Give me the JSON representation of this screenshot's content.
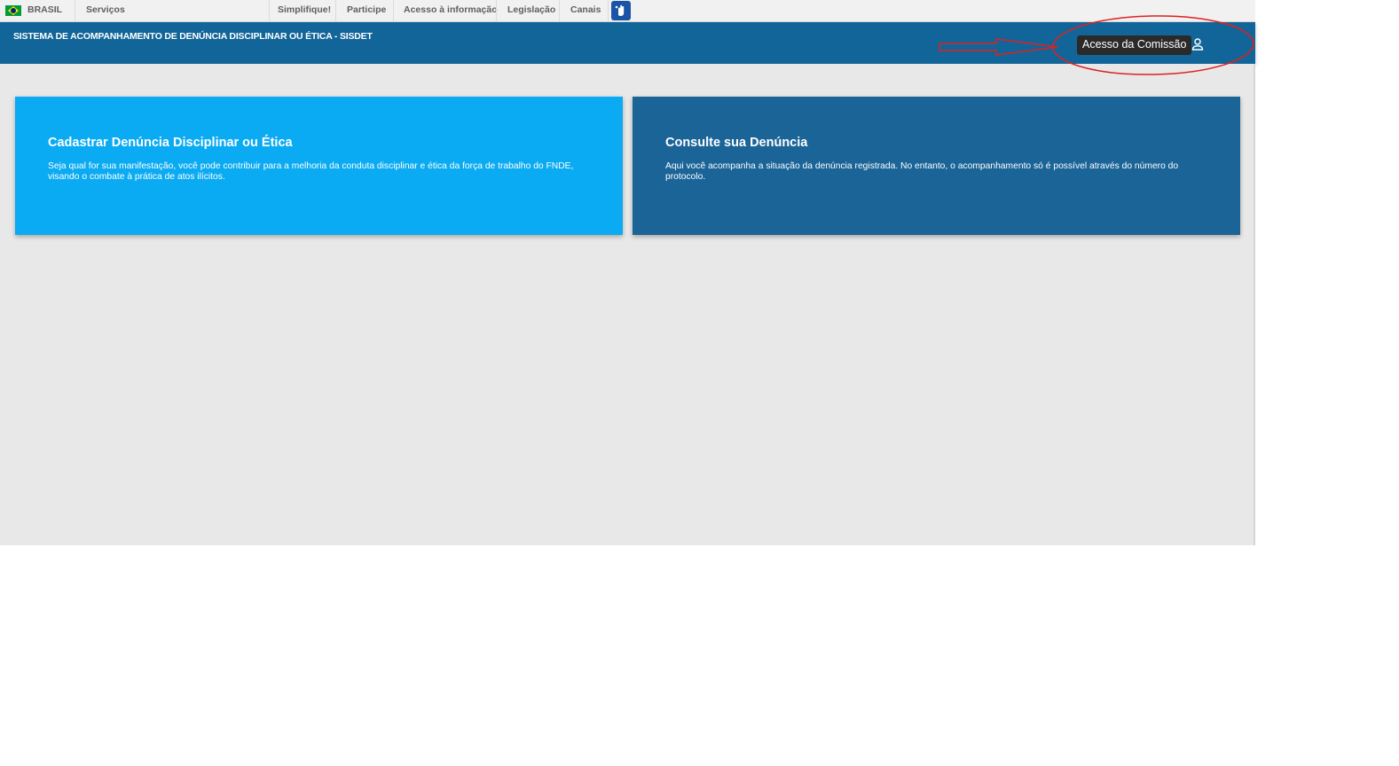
{
  "govbar": {
    "brasil": "BRASIL",
    "servicos": "Serviços",
    "links": [
      "Simplifique!",
      "Participe",
      "Acesso à informação",
      "Legislação",
      "Canais"
    ]
  },
  "header": {
    "title": "SISTEMA DE ACOMPANHAMENTO DE DENÚNCIA DISCIPLINAR OU ÉTICA - SISDET",
    "tooltip": "Acesso da Comissão"
  },
  "cards": [
    {
      "title": "Cadastrar Denúncia Disciplinar ou Ética",
      "text": "Seja qual for sua manifestação, você pode contribuir para a melhoria da conduta disciplinar e ética da força de trabalho do FNDE, visando o combate à prática de atos ilícitos."
    },
    {
      "title": "Consulte sua Denúncia",
      "text": "Aqui você acompanha a situação da denúncia registrada. No entanto, o acompanhamento só é possível através do número do protocolo."
    }
  ],
  "colors": {
    "header": "#126598",
    "card_primary": "#0aabf2",
    "card_secondary": "#1a6497",
    "annotation": "#e02020"
  }
}
